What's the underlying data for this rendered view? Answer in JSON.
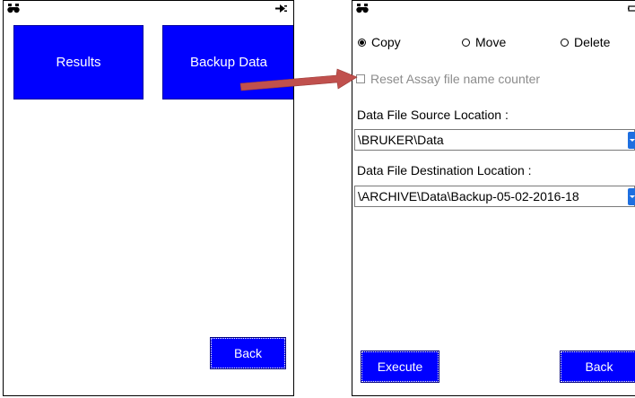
{
  "left_screen": {
    "tiles": {
      "results": "Results",
      "backup_data": "Backup Data"
    },
    "back_label": "Back",
    "status_icons": [
      "binoculars-icon",
      "power-plug-icon"
    ]
  },
  "right_screen": {
    "status_icons": [
      "binoculars-icon",
      "battery-icon"
    ],
    "radios": [
      {
        "label": "Copy",
        "checked": true
      },
      {
        "label": "Move",
        "checked": false
      },
      {
        "label": "Delete",
        "checked": false
      }
    ],
    "reset_checkbox": {
      "label": "Reset Assay file name counter",
      "checked": false,
      "disabled": true
    },
    "source": {
      "label": "Data File Source Location :",
      "value": "\\BRUKER\\Data"
    },
    "destination": {
      "label": "Data File Destination Location :",
      "value": "\\ARCHIVE\\Data\\Backup-05-02-2016-18"
    },
    "execute_label": "Execute",
    "back_label": "Back"
  },
  "colors": {
    "button_blue": "#0000ff",
    "arrow_red": "#c0504d",
    "disabled_gray": "#8c8c8c",
    "dropdown_arrow": "#1e6fe0"
  }
}
